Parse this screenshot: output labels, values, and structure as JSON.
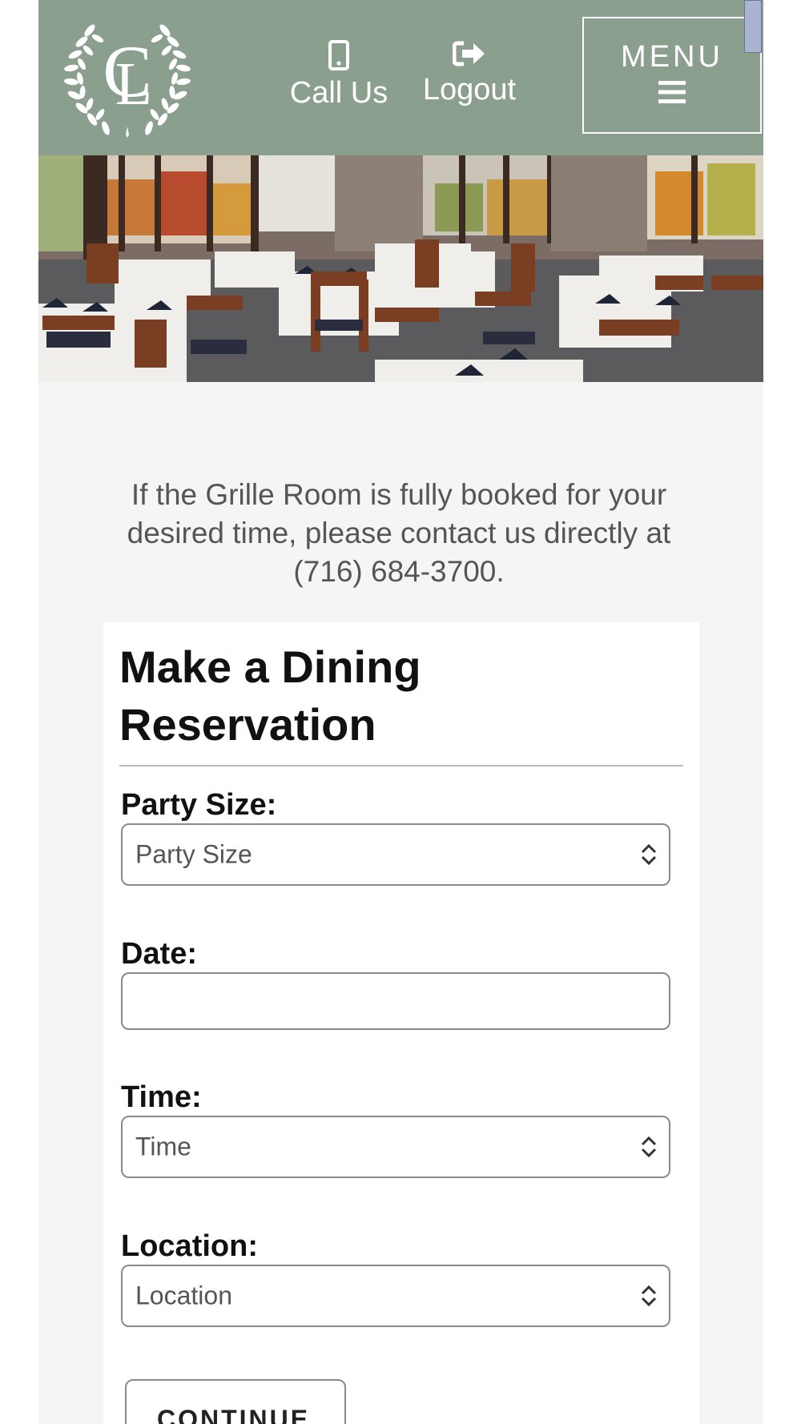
{
  "header": {
    "logo_text": "CL",
    "call_label": "Call Us",
    "logout_label": "Logout",
    "menu_label": "MENU",
    "colors": {
      "background": "#8b9f8e",
      "text": "#ffffff"
    },
    "icons": {
      "call": "mobile-phone-icon",
      "logout": "sign-out-icon",
      "menu": "hamburger-icon"
    }
  },
  "hero": {
    "image": "restaurant-dining-room-photo"
  },
  "notice": {
    "text": "If the Grille Room is fully booked for your desired time, please contact us directly at (716) 684-3700."
  },
  "form": {
    "title": "Make a Dining Reservation",
    "fields": {
      "party_size": {
        "label": "Party Size:",
        "value": "Party Size"
      },
      "date": {
        "label": "Date:",
        "value": ""
      },
      "time": {
        "label": "Time:",
        "value": "Time"
      },
      "location": {
        "label": "Location:",
        "value": "Location"
      }
    },
    "continue_label": "CONTINUE"
  }
}
